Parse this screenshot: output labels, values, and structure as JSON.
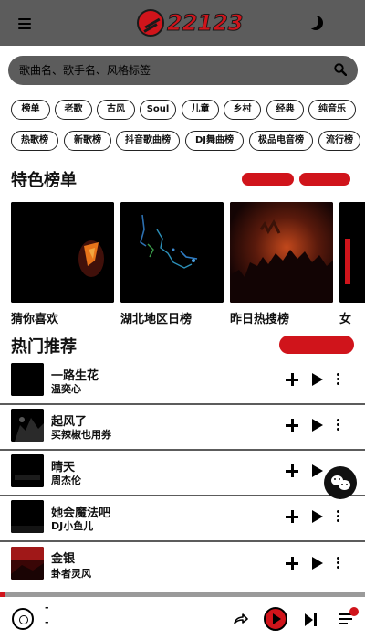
{
  "header": {
    "logo_text": "22123",
    "menu_icon": "hamburger-icon",
    "theme_icon": "moon-icon"
  },
  "search": {
    "placeholder": "歌曲名、歌手名、风格标签",
    "icon": "search-icon"
  },
  "tags_row1": [
    "榜单",
    "老歌",
    "古风",
    "Soul",
    "儿童",
    "乡村",
    "经典",
    "纯音乐"
  ],
  "tags_row2": [
    "热歌榜",
    "新歌榜",
    "抖音歌曲榜",
    "DJ舞曲榜",
    "极品电音榜",
    "流行榜"
  ],
  "featured": {
    "title": "特色榜单",
    "cards": [
      {
        "label": "猜你喜欢"
      },
      {
        "label": "湖北地区日榜"
      },
      {
        "label": "昨日热搜榜"
      },
      {
        "label": "女"
      }
    ]
  },
  "hot": {
    "title": "热门推荐",
    "songs": [
      {
        "title": "一路生花",
        "artist": "温奕心"
      },
      {
        "title": "起风了",
        "artist": "买辣椒也用券"
      },
      {
        "title": "晴天",
        "artist": "周杰伦"
      },
      {
        "title": "她会魔法吧",
        "artist": "DJ小鱼儿"
      },
      {
        "title": "金银",
        "artist": "卦者灵风"
      }
    ]
  },
  "player": {
    "line1": "-",
    "line2": "-",
    "progress": 0
  },
  "colors": {
    "accent": "#d0141b",
    "header_bg": "#5c5c5c"
  }
}
